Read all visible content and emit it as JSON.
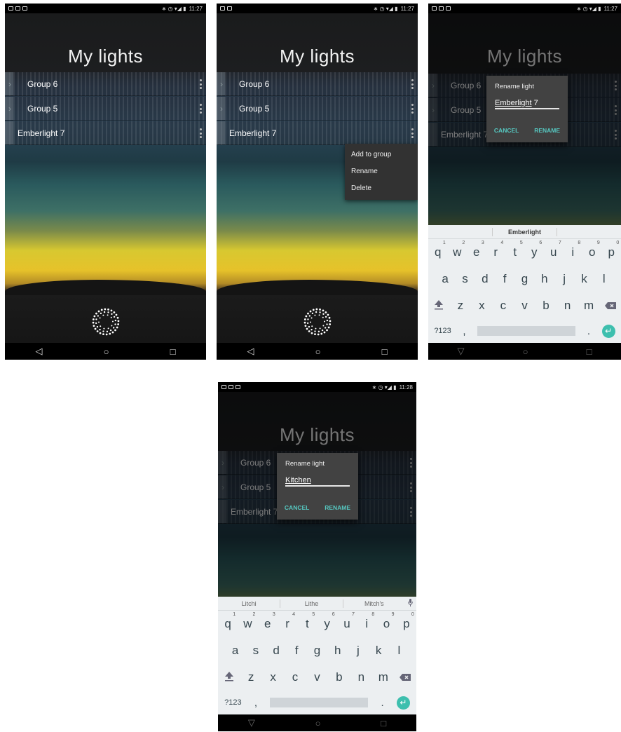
{
  "status": {
    "time_1": "11:27",
    "time_4": "11:28",
    "status_icons": "∗ ◷ ▾◢ ▮"
  },
  "app": {
    "title": "My lights"
  },
  "lights": [
    {
      "label": "Group 6"
    },
    {
      "label": "Group 5"
    },
    {
      "label": "Emberlight 7"
    }
  ],
  "context_menu": {
    "items": [
      "Add to group",
      "Rename",
      "Delete"
    ]
  },
  "rename_dialog": {
    "title": "Rename light",
    "value_initial_underlined": "Emberlight",
    "value_initial_rest": " 7",
    "value_edited": "Kitchen",
    "cancel_label": "CANCEL",
    "rename_label": "RENAME"
  },
  "keyboard": {
    "suggestions_initial": [
      "Emberlight"
    ],
    "suggestions_edited": [
      "Litchi",
      "Lithe",
      "Mitch's"
    ],
    "row1": [
      "q",
      "w",
      "e",
      "r",
      "t",
      "y",
      "u",
      "i",
      "o",
      "p"
    ],
    "row1_digits": [
      "1",
      "2",
      "3",
      "4",
      "5",
      "6",
      "7",
      "8",
      "9",
      "0"
    ],
    "row2": [
      "a",
      "s",
      "d",
      "f",
      "g",
      "h",
      "j",
      "k",
      "l"
    ],
    "row3": [
      "z",
      "x",
      "c",
      "v",
      "b",
      "n",
      "m"
    ],
    "symbols_key": "?123",
    "comma_key": ",",
    "period_key": ".",
    "shift_icon": "shift-arrow",
    "backspace_icon": "backspace",
    "enter_icon": "enter-arrow",
    "mic_icon": "microphone",
    "accent_color": "#3dbfae"
  },
  "nav": {
    "back_icon": "◁",
    "back_icon_alt": "▽",
    "home_icon": "○",
    "recents_icon": "□"
  }
}
